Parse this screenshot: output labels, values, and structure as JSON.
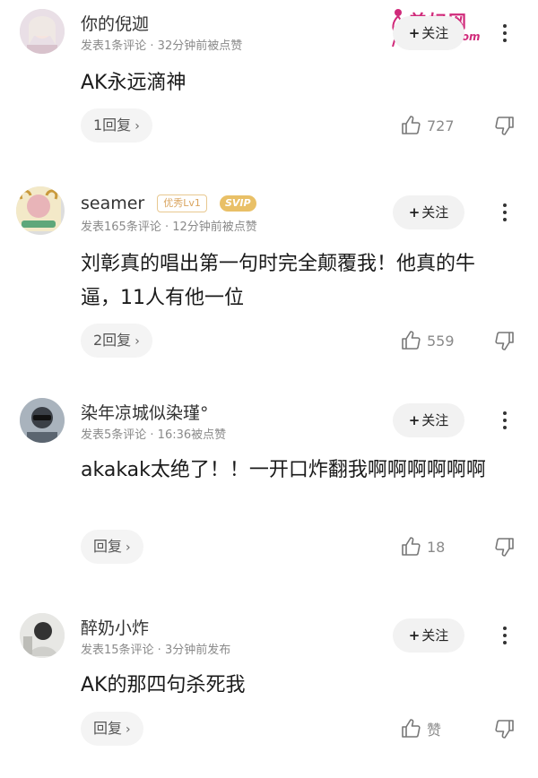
{
  "watermark": {
    "title": "美妇网",
    "url": "inchi43.com"
  },
  "follow_label": "关注",
  "comments": [
    {
      "username": "你的倪迦",
      "meta": "发表1条评论 · 32分钟前被点赞",
      "text": "AK永远滴神",
      "reply_label": "1回复",
      "likes": "727"
    },
    {
      "username": "seamer",
      "badge_level": "优秀Lv1",
      "badge_vip": "SVIP",
      "meta": "发表165条评论 · 12分钟前被点赞",
      "text": "刘彰真的唱出第一句时完全颠覆我！他真的牛逼，11人有他一位",
      "reply_label": "2回复",
      "likes": "559"
    },
    {
      "username": "染年凉城似染瑾°",
      "meta": "发表5条评论 · 16:36被点赞",
      "text": "akakak太绝了！！一开口炸翻我啊啊啊啊啊啊",
      "reply_label": "回复",
      "likes": "18"
    },
    {
      "username": "醉奶小炸",
      "meta": "发表15条评论 · 3分钟前发布",
      "text": "AK的那四句杀死我",
      "reply_label": "回复",
      "likes": "赞"
    }
  ],
  "icons": {
    "like": "thumbs-up-icon",
    "dislike": "thumbs-down-icon",
    "more": "more-vertical-icon",
    "reply_arrow": "chevron-right-icon"
  },
  "colors": {
    "accent_follow_bg": "#f2f2f2",
    "meta_gray": "#8a8a8a",
    "watermark_pink": "#d02a7a",
    "badge_gold": "#e9c067"
  }
}
